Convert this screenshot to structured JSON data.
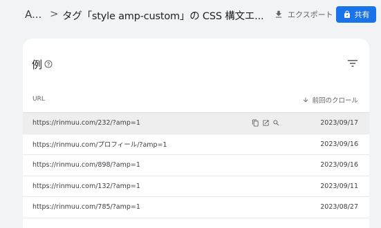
{
  "header": {
    "breadcrumb_root": "A...",
    "breadcrumb_separator": ">",
    "title": "タグ「style amp-custom」の CSS 構文エ...",
    "export_label": "エクスポート",
    "share_label": "共有"
  },
  "card": {
    "title": "例",
    "col_url": "URL",
    "col_date": "前回のクロール"
  },
  "rows": [
    {
      "url": "https://rinmuu.com/232/?amp=1",
      "date": "2023/09/17"
    },
    {
      "url": "https://rinmuu.com/プロフィール/?amp=1",
      "date": "2023/09/16"
    },
    {
      "url": "https://rinmuu.com/898/?amp=1",
      "date": "2023/09/16"
    },
    {
      "url": "https://rinmuu.com/132/?amp=1",
      "date": "2023/09/11"
    },
    {
      "url": "https://rinmuu.com/785/?amp=1",
      "date": "2023/08/27"
    }
  ],
  "colors": {
    "accent": "#1a73e8",
    "background": "#f1f3f4",
    "card": "#ffffff"
  }
}
